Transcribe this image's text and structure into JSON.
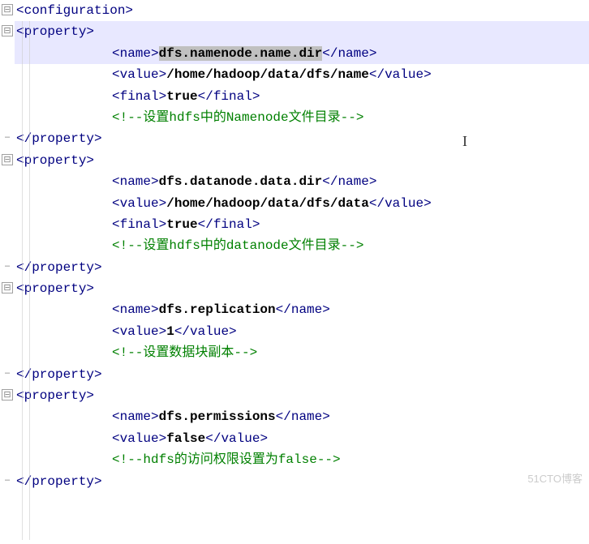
{
  "editor": {
    "root_open": "<configuration>",
    "properties": [
      {
        "name": "dfs.namenode.name.dir",
        "name_selected": true,
        "value": "/home/hadoop/data/dfs/name",
        "final": "true",
        "comment": "<!--设置hdfs中的Namenode文件目录-->"
      },
      {
        "name": "dfs.datanode.data.dir",
        "value": "/home/hadoop/data/dfs/data",
        "final": "true",
        "comment": "<!--设置hdfs中的datanode文件目录-->"
      },
      {
        "name": "dfs.replication",
        "value": "1",
        "comment": "<!--设置数据块副本-->"
      },
      {
        "name": "dfs.permissions",
        "value": "false",
        "comment": "<!--hdfs的访问权限设置为false-->"
      }
    ],
    "tags": {
      "property_open": "<property>",
      "property_close": "</property>",
      "name_open": "<name>",
      "name_close": "</name>",
      "value_open": "<value>",
      "value_close": "</value>",
      "final_open": "<final>",
      "final_close": "</final>"
    },
    "fold": {
      "minus": "⊟",
      "plus": "⊞",
      "end": "–"
    }
  },
  "watermark": "51CTO博客"
}
